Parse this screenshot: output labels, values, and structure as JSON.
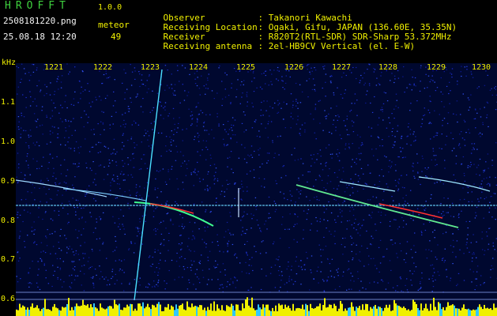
{
  "header": {
    "logo": "HROFFT",
    "version": "1.0.0",
    "filename": "2508181220.png",
    "datetime": "25.08.18 12:20",
    "meteor_label": "meteor",
    "meteor_count": "49"
  },
  "info": [
    {
      "label": "Observer",
      "value": ": Takanori Kawachi"
    },
    {
      "label": "Receiving Location",
      "value": ": Ogaki, Gifu, JAPAN (136.60E, 35.35N)"
    },
    {
      "label": "Receiver",
      "value": ": R820T2(RTL-SDR) SDR-Sharp 53.372MHz"
    },
    {
      "label": "Receiving antenna",
      "value": ": 2el-HB9CV Vertical (el. E-W)"
    }
  ],
  "axis": {
    "y_unit": "kHz",
    "y_ticks": [
      "1.1",
      "1.0",
      "0.9",
      "0.8",
      "0.7",
      "0.6"
    ],
    "x_ticks": [
      "1221",
      "1222",
      "1223",
      "1224",
      "1225",
      "1226",
      "1227",
      "1228",
      "1229",
      "1230"
    ]
  },
  "colors": {
    "background": "#000000",
    "spectrum_bg": "#000a3a",
    "noise": "#1a2cc8",
    "signal_strong": "#ff3030",
    "signal_mid": "#40ff90",
    "baseline_yellow": "#f0f000"
  }
}
